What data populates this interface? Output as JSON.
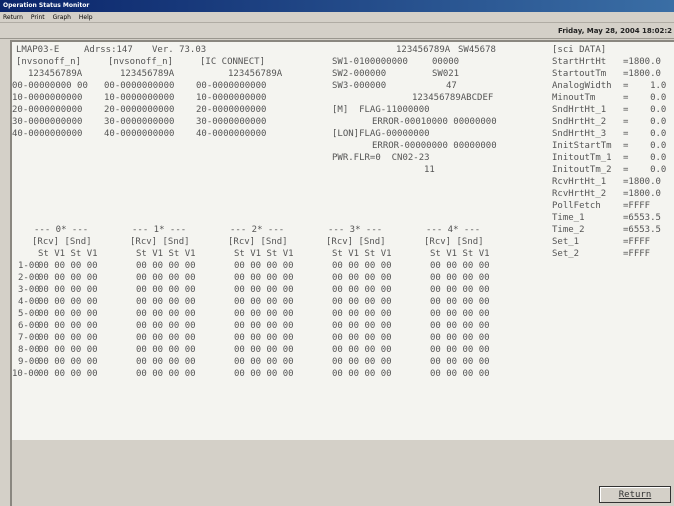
{
  "window": {
    "title": "Operation Status Monitor",
    "menu": [
      "Return",
      "Print",
      "Graph",
      "Help"
    ],
    "date": "Friday, May 28, 2004 18:02:2"
  },
  "header": {
    "unit": "LMAP03-E",
    "address": "Adrss:147",
    "version": "Ver. 73.03",
    "hex_main": "123456789A",
    "sw_main": "SW45678",
    "data_title": "[sci DATA]"
  },
  "left_block": {
    "col_titles": [
      "[nvsonoff_n]",
      "[nvsonoff_n]",
      "[IC CONNECT]"
    ],
    "hex_row": [
      "123456789A",
      "123456789A",
      "123456789A"
    ],
    "rows": [
      [
        "00-00000000 00",
        "00-0000000000",
        "00-0000000000"
      ],
      [
        "10-0000000000",
        "10-0000000000",
        "10-0000000000"
      ],
      [
        "20-0000000000",
        "20-0000000000",
        "20-0000000000"
      ],
      [
        "30-0000000000",
        "30-0000000000",
        "30-0000000000"
      ],
      [
        "40-0000000000",
        "40-0000000000",
        "40-0000000000"
      ]
    ]
  },
  "mid_block": {
    "sw1": "SW1-0100000000",
    "sw1_val": "00000",
    "sw2": "SW2-000000",
    "sw2_val": "SW021",
    "sw3": "SW3-000000",
    "sw3_val": "47",
    "hex_long": "123456789ABCDEF",
    "m_flag": "[M]  FLAG-11000000",
    "m_error": "ERROR-00010000 00000000",
    "lon_flag": "[LON]FLAG-00000000",
    "lon_error": "ERROR-00000000 00000000",
    "pwr": "PWR.FLR=0  CN02-23",
    "pwr2": "11"
  },
  "params": [
    {
      "name": "StartHrtHt",
      "value": "=1800.0"
    },
    {
      "name": "StartoutTm",
      "value": "=1800.0"
    },
    {
      "name": "AnalogWidth",
      "value": "=    1.0"
    },
    {
      "name": "MinoutTm",
      "value": "=    0.0"
    },
    {
      "name": "SndHrtHt_1",
      "value": "=    0.0"
    },
    {
      "name": "SndHrtHt_2",
      "value": "=    0.0"
    },
    {
      "name": "SndHrtHt_3",
      "value": "=    0.0"
    },
    {
      "name": "InitStartTm",
      "value": "=    0.0"
    },
    {
      "name": "InitoutTm_1",
      "value": "=    0.0"
    },
    {
      "name": "InitoutTm_2",
      "value": "=    0.0"
    },
    {
      "name": "RcvHrtHt_1",
      "value": "=1800.0"
    },
    {
      "name": "RcvHrtHt_2",
      "value": "=1800.0"
    },
    {
      "name": "PollFetch",
      "value": "=FFFF"
    },
    {
      "name": "Time_1",
      "value": "=6553.5"
    },
    {
      "name": "Time_2",
      "value": "=6553.5"
    },
    {
      "name": "Set_1",
      "value": "=FFFF"
    },
    {
      "name": "Set_2",
      "value": "=FFFF"
    }
  ],
  "grid": {
    "groups": [
      "--- 0* ---",
      "--- 1* ---",
      "--- 2* ---",
      "--- 3* ---",
      "--- 4* ---"
    ],
    "subheader": "[Rcv] [Snd]",
    "colheader": "St V1 St V1",
    "cell": "00 00 00 00",
    "rows": [
      "1-00",
      "2-00",
      "3-00",
      "4-00",
      "5-00",
      "6-00",
      "7-00",
      "8-00",
      "9-00",
      "10-00"
    ]
  },
  "footer": {
    "return_label": "Return"
  }
}
